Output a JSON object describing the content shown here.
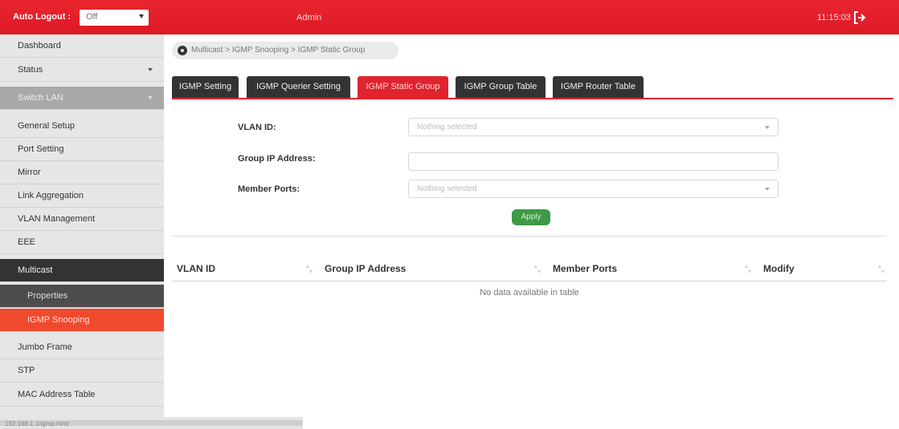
{
  "topbar": {
    "auto_logout_label": "Auto Logout :",
    "auto_logout_value": "Off",
    "user": "Admin",
    "time": "11:15:03"
  },
  "sidebar": {
    "items": [
      {
        "label": "Dashboard"
      },
      {
        "label": "Status"
      },
      {
        "label": "Switch LAN"
      },
      {
        "label": "General Setup"
      },
      {
        "label": "Port Setting"
      },
      {
        "label": "Mirror"
      },
      {
        "label": "Link Aggregation"
      },
      {
        "label": "VLAN Management"
      },
      {
        "label": "EEE"
      },
      {
        "label": "Multicast"
      },
      {
        "label": "Properties"
      },
      {
        "label": "IGMP Snooping"
      },
      {
        "label": "Jumbo Frame"
      },
      {
        "label": "STP"
      },
      {
        "label": "MAC Address Table"
      }
    ],
    "status_text": "192.168.1.1/igmp.html"
  },
  "breadcrumb": "Multicast > IGMP Snooping > IGMP Static Group",
  "tabs": [
    {
      "label": "IGMP Setting"
    },
    {
      "label": "IGMP Querier Setting"
    },
    {
      "label": "IGMP Static Group"
    },
    {
      "label": "IGMP Group Table"
    },
    {
      "label": "IGMP Router Table"
    }
  ],
  "form": {
    "vlan_label": "VLAN ID:",
    "vlan_value": "Nothing selected",
    "group_ip_label": "Group IP Address:",
    "group_ip_value": "",
    "member_ports_label": "Member Ports:",
    "member_ports_value": "Nothing selected",
    "apply_label": "Apply"
  },
  "table": {
    "columns": [
      "VLAN ID",
      "Group IP Address",
      "Member Ports",
      "Modify"
    ],
    "empty_text": "No data available in table"
  },
  "colors": {
    "brand_red": "#e0232e",
    "active_menu": "#f04a2e",
    "apply_green": "#3d9a46"
  }
}
